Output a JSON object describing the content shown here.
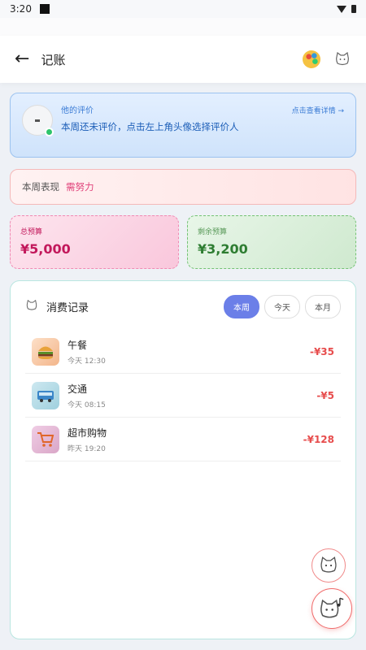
{
  "status_bar": {
    "time": "3:20"
  },
  "app_bar": {
    "title": "记账"
  },
  "rater": {
    "label": "他的评价",
    "message": "本周还未评价，点击左上角头像选择评价人",
    "link": "点击查看详情 →"
  },
  "performance": {
    "label": "本周表现",
    "value": "需努力"
  },
  "budget": {
    "total_label": "总预算",
    "total_value": "¥5,000",
    "remain_label": "剩余预算",
    "remain_value": "¥3,200"
  },
  "records": {
    "title": "消费记录",
    "tabs": [
      {
        "label": "本周",
        "active": true
      },
      {
        "label": "今天",
        "active": false
      },
      {
        "label": "本月",
        "active": false
      }
    ],
    "items": [
      {
        "name": "午餐",
        "time": "今天 12:30",
        "amount": "-¥35",
        "icon": "burger-icon"
      },
      {
        "name": "交通",
        "time": "今天 08:15",
        "amount": "-¥5",
        "icon": "bus-icon"
      },
      {
        "name": "超市购物",
        "time": "昨天 19:20",
        "amount": "-¥128",
        "icon": "cart-icon"
      }
    ]
  },
  "colors": {
    "accent": "#6b7fe8",
    "expense": "#e74c4c",
    "positive": "#2e7d32",
    "warning": "#e0427a"
  }
}
